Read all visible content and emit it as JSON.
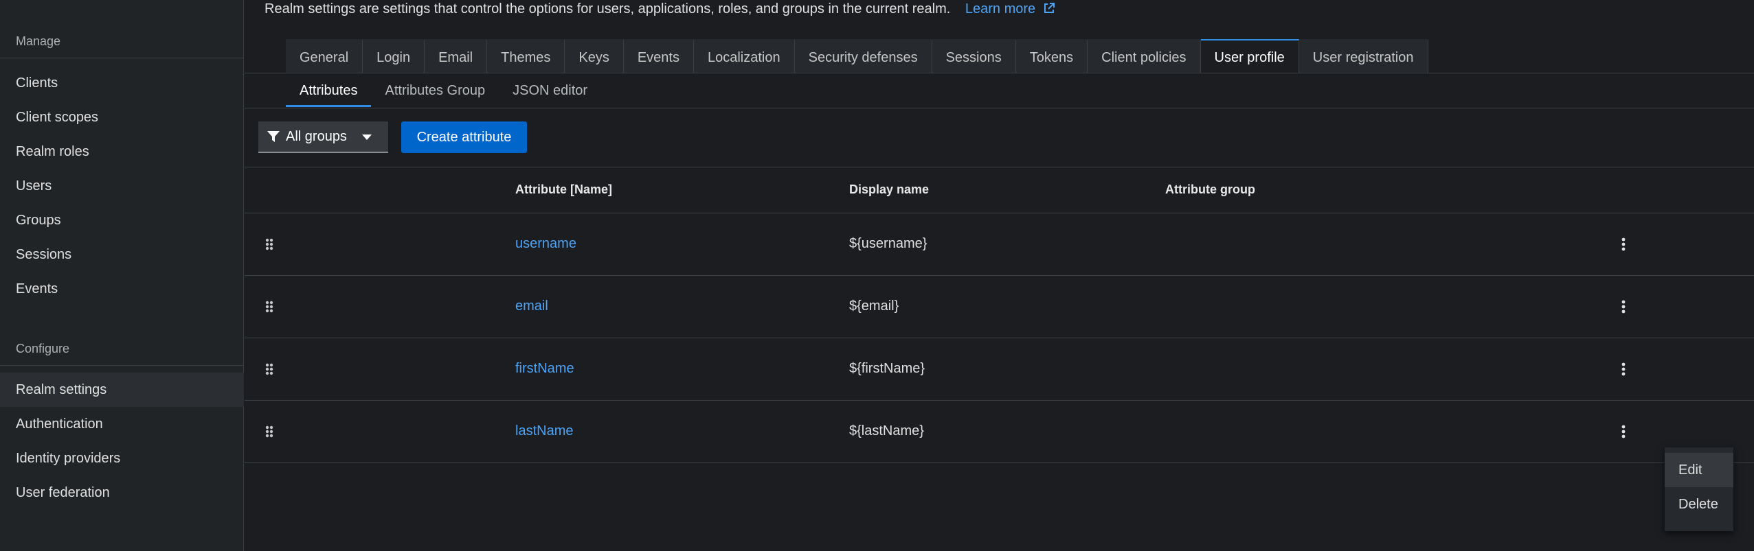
{
  "sidebar": {
    "sections": [
      {
        "title": "Manage",
        "items": [
          {
            "label": "Clients",
            "active": false
          },
          {
            "label": "Client scopes",
            "active": false
          },
          {
            "label": "Realm roles",
            "active": false
          },
          {
            "label": "Users",
            "active": false
          },
          {
            "label": "Groups",
            "active": false
          },
          {
            "label": "Sessions",
            "active": false
          },
          {
            "label": "Events",
            "active": false
          }
        ]
      },
      {
        "title": "Configure",
        "items": [
          {
            "label": "Realm settings",
            "active": true
          },
          {
            "label": "Authentication",
            "active": false
          },
          {
            "label": "Identity providers",
            "active": false
          },
          {
            "label": "User federation",
            "active": false
          }
        ]
      }
    ]
  },
  "intro": {
    "text": "Realm settings are settings that control the options for users, applications, roles, and groups in the current realm.",
    "learn_more": "Learn more",
    "learn_more_icon": "external-link-icon"
  },
  "tabs": [
    "General",
    "Login",
    "Email",
    "Themes",
    "Keys",
    "Events",
    "Localization",
    "Security defenses",
    "Sessions",
    "Tokens",
    "Client policies",
    "User profile",
    "User registration"
  ],
  "active_tab": "User profile",
  "subtabs": [
    "Attributes",
    "Attributes Group",
    "JSON editor"
  ],
  "active_subtab": "Attributes",
  "toolbar": {
    "filter_label": "All groups",
    "filter_icon": "filter-icon",
    "create_label": "Create attribute"
  },
  "table": {
    "columns": [
      "Attribute [Name]",
      "Display name",
      "Attribute group"
    ],
    "rows": [
      {
        "name": "username",
        "display_name": "${username}",
        "group": ""
      },
      {
        "name": "email",
        "display_name": "${email}",
        "group": ""
      },
      {
        "name": "firstName",
        "display_name": "${firstName}",
        "group": ""
      },
      {
        "name": "lastName",
        "display_name": "${lastName}",
        "group": ""
      }
    ]
  },
  "row_menu": {
    "items": [
      "Edit",
      "Delete"
    ],
    "hovered": "Edit"
  },
  "colors": {
    "accent": "#2f8fe8",
    "link": "#4da3f5",
    "primary_button": "#0066cc",
    "background": "#1b1d21",
    "sidebar_background": "#212427"
  }
}
